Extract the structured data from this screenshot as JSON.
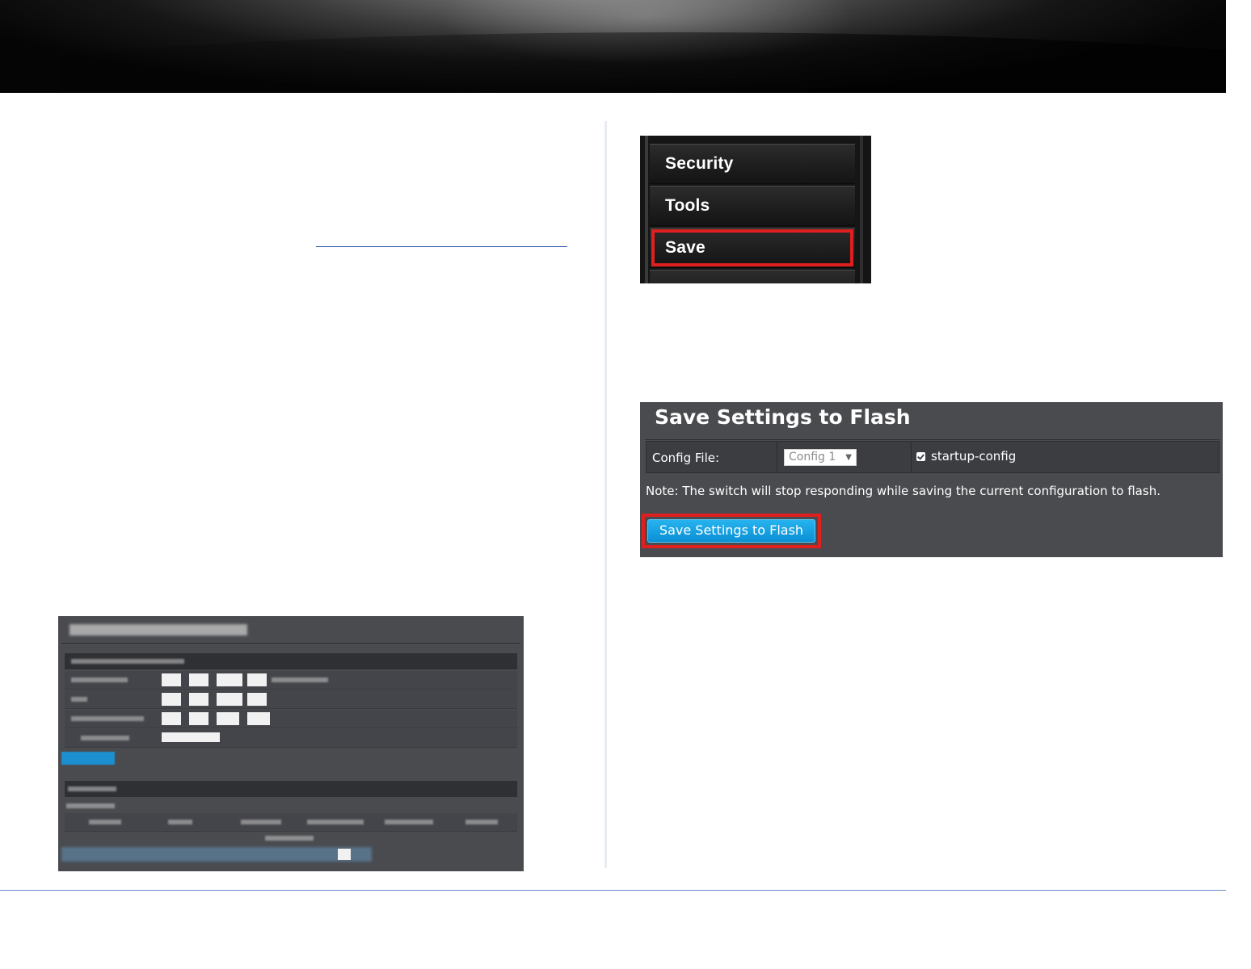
{
  "menu": {
    "items": [
      {
        "label": "Security"
      },
      {
        "label": "Tools"
      },
      {
        "label": "Save",
        "highlighted": true
      }
    ]
  },
  "save_panel": {
    "title": "Save Settings to Flash",
    "config_file_label": "Config File:",
    "config_select_value": "Config 1",
    "startup_config_label": "startup-config",
    "startup_config_checked": true,
    "note": "Note: The switch will stop responding while saving the current configuration to flash.",
    "button_label": "Save Settings to Flash"
  },
  "colors": {
    "highlight_red": "#e01f1f",
    "panel_bg": "#4a4b4f",
    "button_blue": "#1a9fe0",
    "link_blue": "#1f4ea3"
  }
}
